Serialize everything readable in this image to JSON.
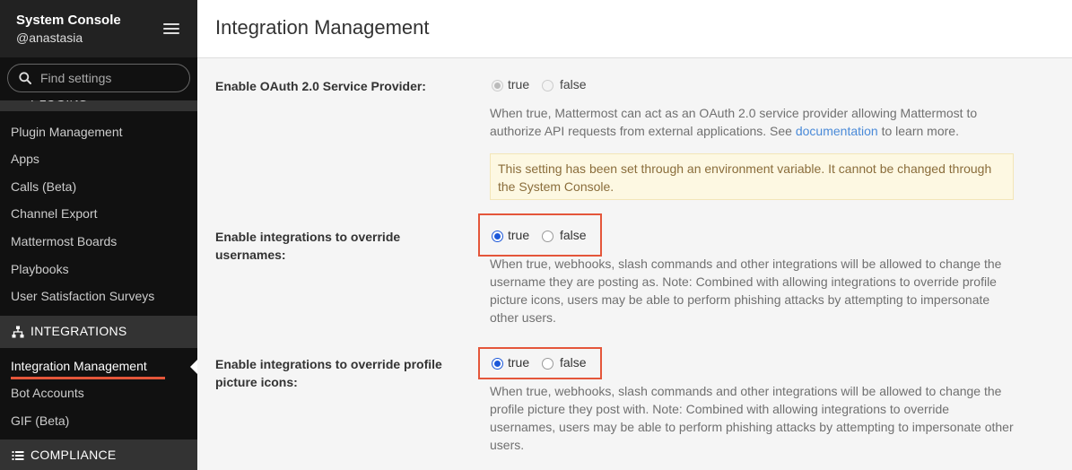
{
  "sidebar": {
    "title": "System Console",
    "username": "@anastasia",
    "search_placeholder": "Find settings",
    "cut_section_label": "PLUGINS",
    "plugin_items": [
      "Plugin Management",
      "Apps",
      "Calls (Beta)",
      "Channel Export",
      "Mattermost Boards",
      "Playbooks",
      "User Satisfaction Surveys"
    ],
    "integrations_section": "INTEGRATIONS",
    "integration_items": [
      "Integration Management",
      "Bot Accounts",
      "GIF (Beta)"
    ],
    "active_item": "Integration Management",
    "compliance_section": "COMPLIANCE",
    "accent_color": "#e4563a"
  },
  "page": {
    "title": "Integration Management"
  },
  "settings": {
    "oauth": {
      "label": "Enable OAuth 2.0 Service Provider:",
      "true_label": "true",
      "false_label": "false",
      "selected": "true",
      "disabled": true,
      "help_before": "When true, Mattermost can act as an OAuth 2.0 service provider allowing Mattermost to authorize API requests from external applications. See ",
      "help_link": "documentation",
      "help_after": " to learn more.",
      "warning": "This setting has been set through an environment variable. It cannot be changed through the System Console."
    },
    "override_usernames": {
      "label": "Enable integrations to override usernames:",
      "true_label": "true",
      "false_label": "false",
      "selected": "true",
      "help": "When true, webhooks, slash commands and other integrations will be allowed to change the username they are posting as. Note: Combined with allowing integrations to override profile picture icons, users may be able to perform phishing attacks by attempting to impersonate other users."
    },
    "override_icons": {
      "label": "Enable integrations to override profile picture icons:",
      "true_label": "true",
      "false_label": "false",
      "selected": "true",
      "help": "When true, webhooks, slash commands and other integrations will be allowed to change the profile picture they post with. Note: Combined with allowing integrations to override usernames, users may be able to perform phishing attacks by attempting to impersonate other users."
    }
  }
}
